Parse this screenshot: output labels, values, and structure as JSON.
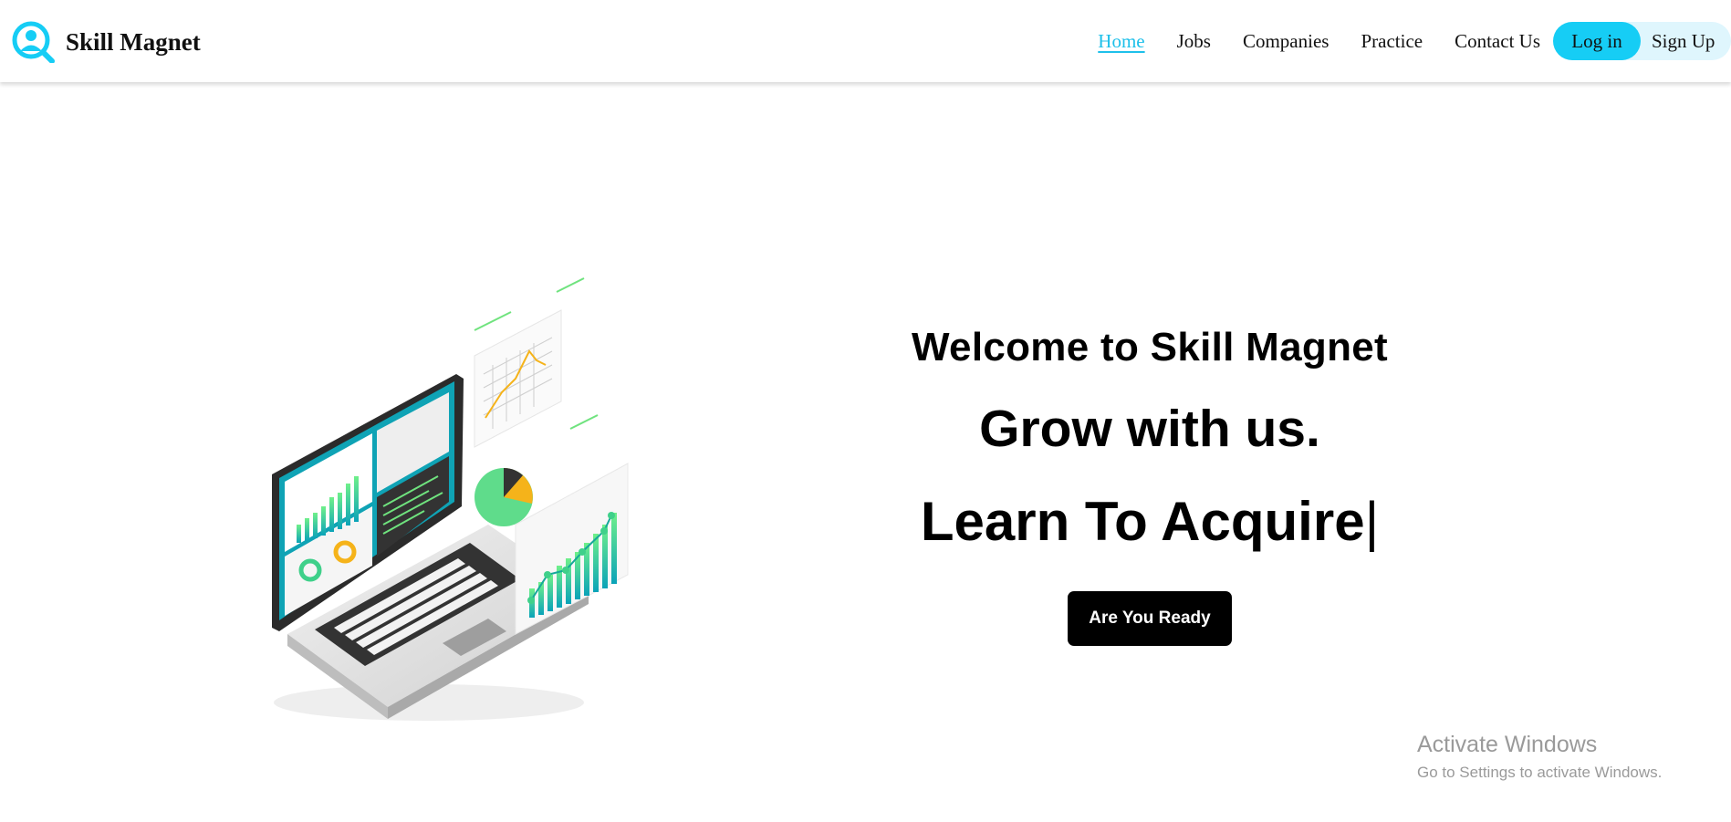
{
  "brand": {
    "name": "Skill Magnet",
    "logo_icon": "magnet-user-icon",
    "accent": "#16cdf5"
  },
  "nav": {
    "items": [
      {
        "label": "Home",
        "active": true
      },
      {
        "label": "Jobs",
        "active": false
      },
      {
        "label": "Companies",
        "active": false
      },
      {
        "label": "Practice",
        "active": false
      },
      {
        "label": "Contact Us",
        "active": false
      }
    ],
    "login_label": "Log in",
    "signup_label": "Sign Up"
  },
  "hero": {
    "welcome": "Welcome to Skill Magnet",
    "tagline": "Grow with us.",
    "typing_text": "Learn To Acquire",
    "cursor": "|",
    "cta_label": "Are You Ready",
    "illustration": "laptop-analytics-illustration"
  },
  "watermark": {
    "title": "Activate Windows",
    "subtitle": "Go to Settings to activate Windows."
  }
}
